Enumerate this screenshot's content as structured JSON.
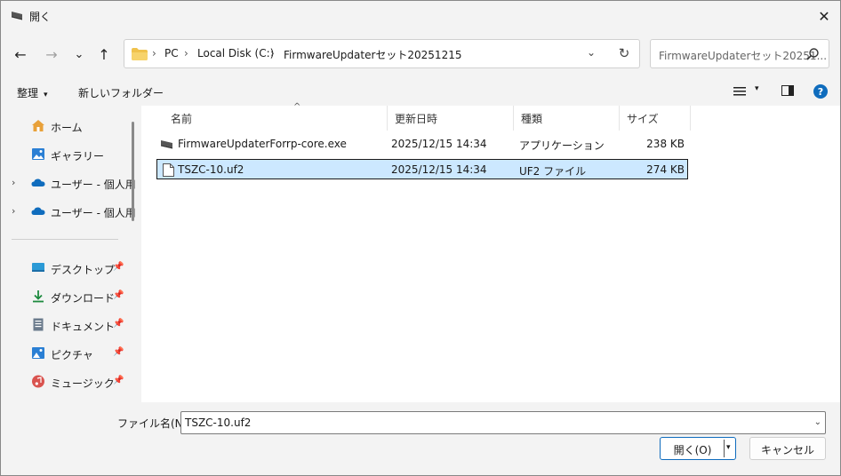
{
  "window": {
    "title": "開く",
    "close_glyph": "✕"
  },
  "nav": {
    "back_glyph": "←",
    "forward_glyph": "→",
    "recent_glyph": "⌄",
    "up_glyph": "↑",
    "breadcrumbs": [
      "PC",
      "Local Disk (C:)",
      "FirmwareUpdaterセット20251215"
    ],
    "separator": "›",
    "dropdown_glyph": "⌄",
    "refresh_glyph": "↻",
    "search_placeholder": "FirmwareUpdaterセット20251..."
  },
  "toolbar": {
    "organize_label": "整理",
    "organize_caret": "▾",
    "new_folder_label": "新しいフォルダー",
    "view_caret": "▾",
    "help_glyph": "?"
  },
  "sidebar": {
    "expand_glyph": "›",
    "pin_glyph": "📌",
    "items": [
      {
        "label": "ホーム",
        "icon": "home-icon",
        "expandable": false,
        "pinned": false
      },
      {
        "label": "ギャラリー",
        "icon": "gallery-icon",
        "expandable": false,
        "pinned": false
      },
      {
        "label": "ユーザー - 個人用",
        "icon": "onedrive-cloud-icon",
        "expandable": true,
        "pinned": false
      },
      {
        "label": "ユーザー - 個人用",
        "icon": "onedrive-cloud-icon",
        "expandable": true,
        "pinned": false
      },
      {
        "label": "デスクトップ",
        "icon": "desktop-icon",
        "expandable": false,
        "pinned": true
      },
      {
        "label": "ダウンロード",
        "icon": "download-icon",
        "expandable": false,
        "pinned": true
      },
      {
        "label": "ドキュメント",
        "icon": "document-icon",
        "expandable": false,
        "pinned": true
      },
      {
        "label": "ピクチャ",
        "icon": "pictures-icon",
        "expandable": false,
        "pinned": true
      },
      {
        "label": "ミュージック",
        "icon": "music-icon",
        "expandable": false,
        "pinned": true
      }
    ]
  },
  "filelist": {
    "sort_caret": "^",
    "columns": {
      "name": "名前",
      "modified": "更新日時",
      "type": "種類",
      "size": "サイズ"
    },
    "files": [
      {
        "name": "FirmwareUpdaterForrp-core.exe",
        "modified": "2025/12/15 14:34",
        "type": "アプリケーション",
        "size": "238 KB",
        "icon": "application-icon",
        "selected": false
      },
      {
        "name": "TSZC-10.uf2",
        "modified": "2025/12/15 14:34",
        "type": "UF2 ファイル",
        "size": "274 KB",
        "icon": "blank-file-icon",
        "selected": true
      }
    ]
  },
  "bottom": {
    "filename_label": "ファイル名(N):",
    "filename_value": "TSZC-10.uf2",
    "filename_dd_glyph": "⌄",
    "open_label": "開く(O)",
    "open_dd_glyph": "▾",
    "cancel_label": "キャンセル"
  },
  "colors": {
    "accent": "#0f6cbd",
    "selection": "#cce8ff",
    "folder": "#f0c24c"
  }
}
